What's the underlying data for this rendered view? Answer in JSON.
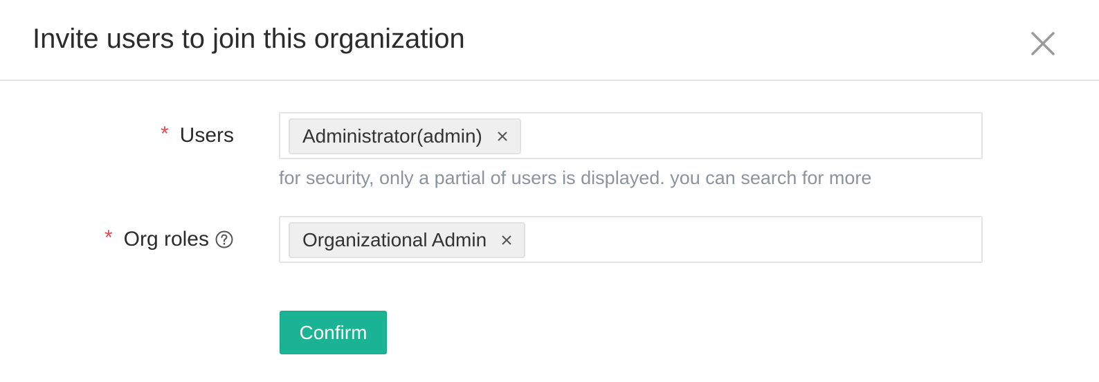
{
  "dialog": {
    "title": "Invite users to join this organization",
    "close_icon": "close-icon"
  },
  "form": {
    "users": {
      "required_mark": "*",
      "label": "Users",
      "selected": [
        {
          "label": "Administrator(admin)",
          "remove_icon": "close-icon"
        }
      ],
      "hint": "for security, only a partial of users is displayed. you can search for more"
    },
    "org_roles": {
      "required_mark": "*",
      "label": "Org roles",
      "help_icon": "question-circle-icon",
      "selected": [
        {
          "label": "Organizational Admin",
          "remove_icon": "close-icon"
        }
      ]
    }
  },
  "actions": {
    "confirm_label": "Confirm"
  },
  "colors": {
    "accent": "#1ab394",
    "required": "#e5484d",
    "hint": "#8c939d",
    "tag_bg": "#efefef",
    "border": "#e3e4e6"
  }
}
